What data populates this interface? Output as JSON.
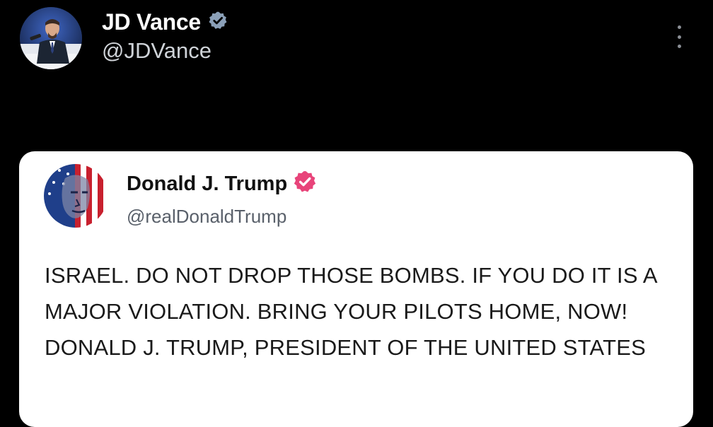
{
  "post": {
    "author": {
      "name": "JD Vance",
      "handle": "@JDVance",
      "verified_icon": "verified-badge-icon",
      "verified_color": "#8ba0b8"
    },
    "more_icon": "more-vertical-icon"
  },
  "quoted_post": {
    "author": {
      "name": "Donald J. Trump",
      "handle": "@realDonaldTrump",
      "verified_icon": "verified-badge-icon",
      "verified_color": "#e8447a"
    },
    "body": "ISRAEL. DO NOT DROP THOSE BOMBS. IF YOU DO IT IS A MAJOR VIOLATION. BRING YOUR PILOTS HOME, NOW! DONALD J. TRUMP, PRESIDENT OF THE UNITED STATES"
  },
  "colors": {
    "background": "#000000",
    "card_background": "#ffffff",
    "handle_dark": "#cfd3d8",
    "handle_light": "#59606a"
  }
}
